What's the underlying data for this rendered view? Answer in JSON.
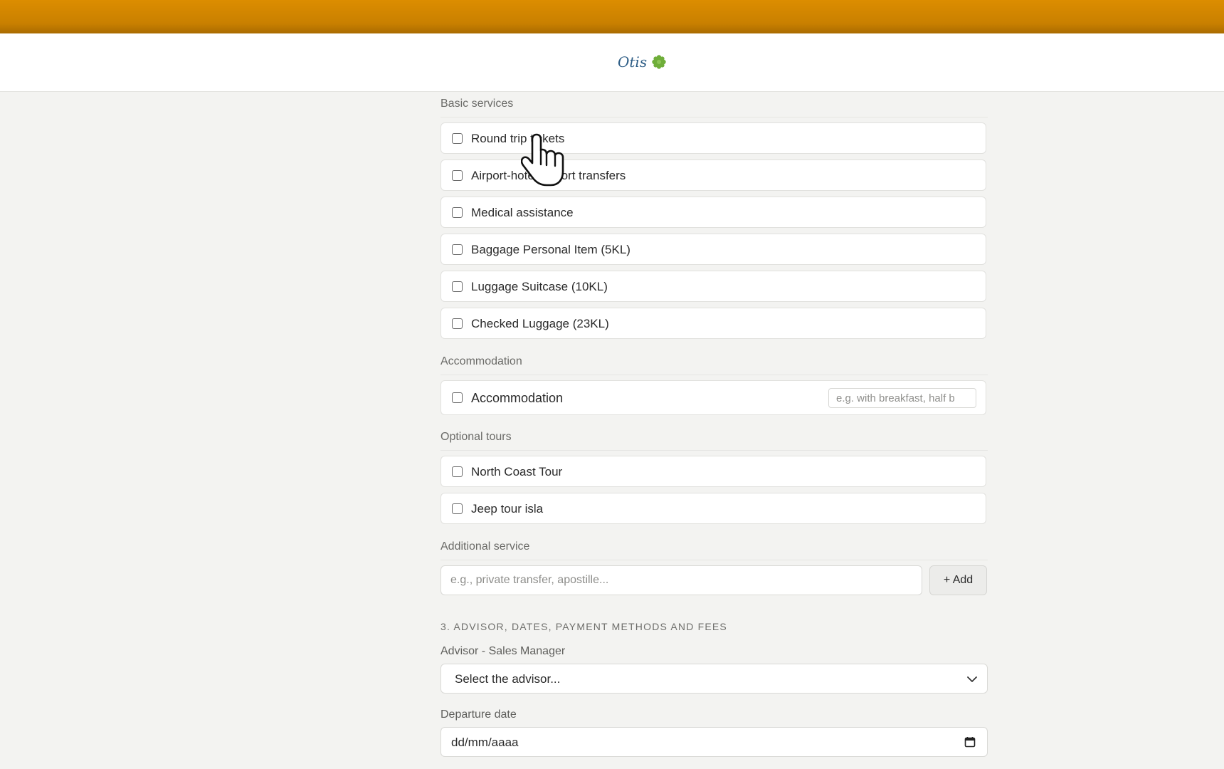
{
  "header": {
    "brand_name": "Otis",
    "brand_icon": "green-leaf-icon",
    "accent_color": "#d08a00"
  },
  "basic_services": {
    "title": "Basic services",
    "items": [
      {
        "label": "Round trip tickets",
        "checked": false
      },
      {
        "label": "Airport-hotel-airport transfers",
        "checked": false
      },
      {
        "label": "Medical assistance",
        "checked": false
      },
      {
        "label": "Baggage Personal Item (5KL)",
        "checked": false
      },
      {
        "label": "Luggage Suitcase (10KL)",
        "checked": false
      },
      {
        "label": "Checked Luggage (23KL)",
        "checked": false
      }
    ]
  },
  "accommodation": {
    "title": "Accommodation",
    "label": "Accommodation",
    "checked": false,
    "placeholder": "e.g. with breakfast, half b"
  },
  "optional_tours": {
    "title": "Optional tours",
    "items": [
      {
        "label": "North Coast Tour",
        "checked": false
      },
      {
        "label": "Jeep tour isla",
        "checked": false
      }
    ]
  },
  "additional_service": {
    "title": "Additional service",
    "placeholder": "e.g., private transfer, apostille...",
    "add_label": "+ Add"
  },
  "step3": {
    "title": "3. ADVISOR, DATES, PAYMENT METHODS AND FEES",
    "advisor_label": "Advisor - Sales Manager",
    "advisor_value": "Select the advisor...",
    "departure_label": "Departure date",
    "departure_value": "dd/mm/aaaa"
  }
}
